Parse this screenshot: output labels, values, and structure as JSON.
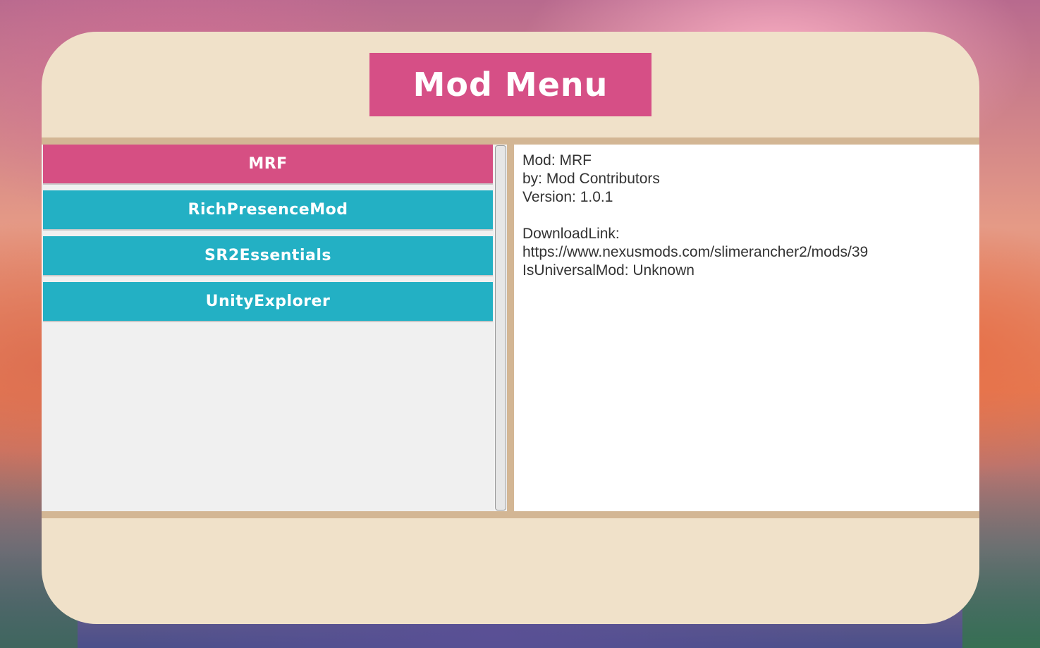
{
  "title": "Mod Menu",
  "mods": [
    {
      "name": "MRF",
      "selected": true
    },
    {
      "name": "RichPresenceMod",
      "selected": false
    },
    {
      "name": "SR2Essentials",
      "selected": false
    },
    {
      "name": "UnityExplorer",
      "selected": false
    }
  ],
  "details": {
    "mod_line": "Mod: MRF",
    "author_line": "by: Mod Contributors",
    "version_line": "Version: 1.0.1",
    "download_label": "DownloadLink:",
    "download_url": "https://www.nexusmods.com/slimerancher2/mods/39",
    "universal_line": "IsUniversalMod: Unknown"
  },
  "colors": {
    "selected": "#d64f83",
    "normal": "#23b0c4",
    "title_bg": "#d64f86",
    "panel_bg": "#f0e1c9"
  }
}
